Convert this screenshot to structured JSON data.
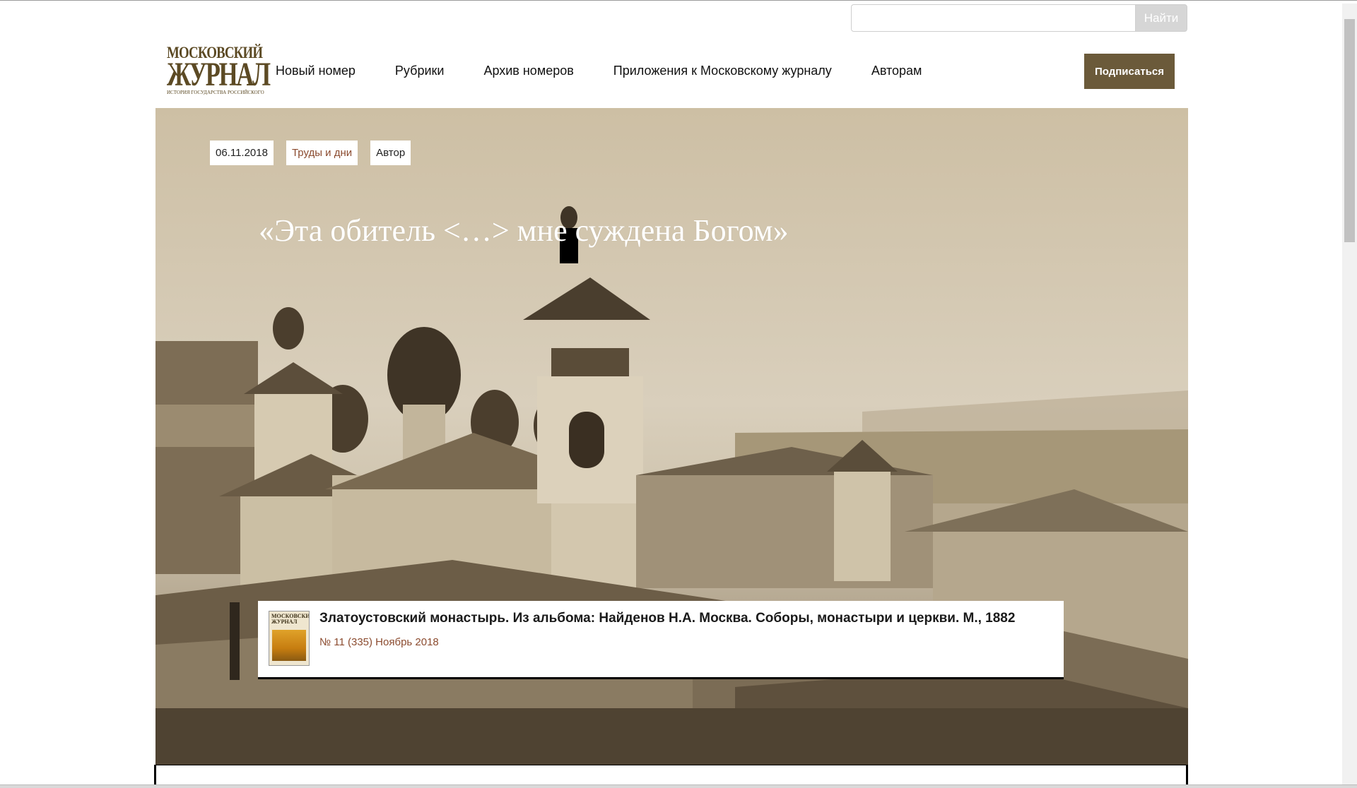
{
  "search": {
    "placeholder": "",
    "value": "",
    "button_label": "Найти"
  },
  "logo": {
    "line1": "МОСКОВСКИЙ",
    "line2": "ЖУРНАЛ",
    "line3": "ИСТОРИЯ ГОСУДАРСТВА РОССИЙСКОГО"
  },
  "nav": {
    "items": [
      {
        "label": "Новый номер"
      },
      {
        "label": "Рубрики"
      },
      {
        "label": "Архив номеров"
      },
      {
        "label": "Приложения к Московскому журналу"
      },
      {
        "label": "Авторам"
      }
    ]
  },
  "subscribe_label": "Подписаться",
  "article": {
    "date": "06.11.2018",
    "rubric": "Труды и дни",
    "author": "Автор",
    "title": "«Эта обитель <…> мне суждена Богом»",
    "caption": "Златоустовский монастырь. Из альбома: Найденов Н.А. Москва. Соборы, монастыри и церкви. М., 1882",
    "issue": "№ 11 (335) Ноябрь 2018",
    "thumb_title": "МОСКОВСКИЙ ЖУРНАЛ"
  },
  "colors": {
    "accent": "#6b5a3a",
    "link": "#8b4b2f",
    "sepia_light": "#d8cfbd",
    "sepia_dark": "#4a3d2c"
  }
}
